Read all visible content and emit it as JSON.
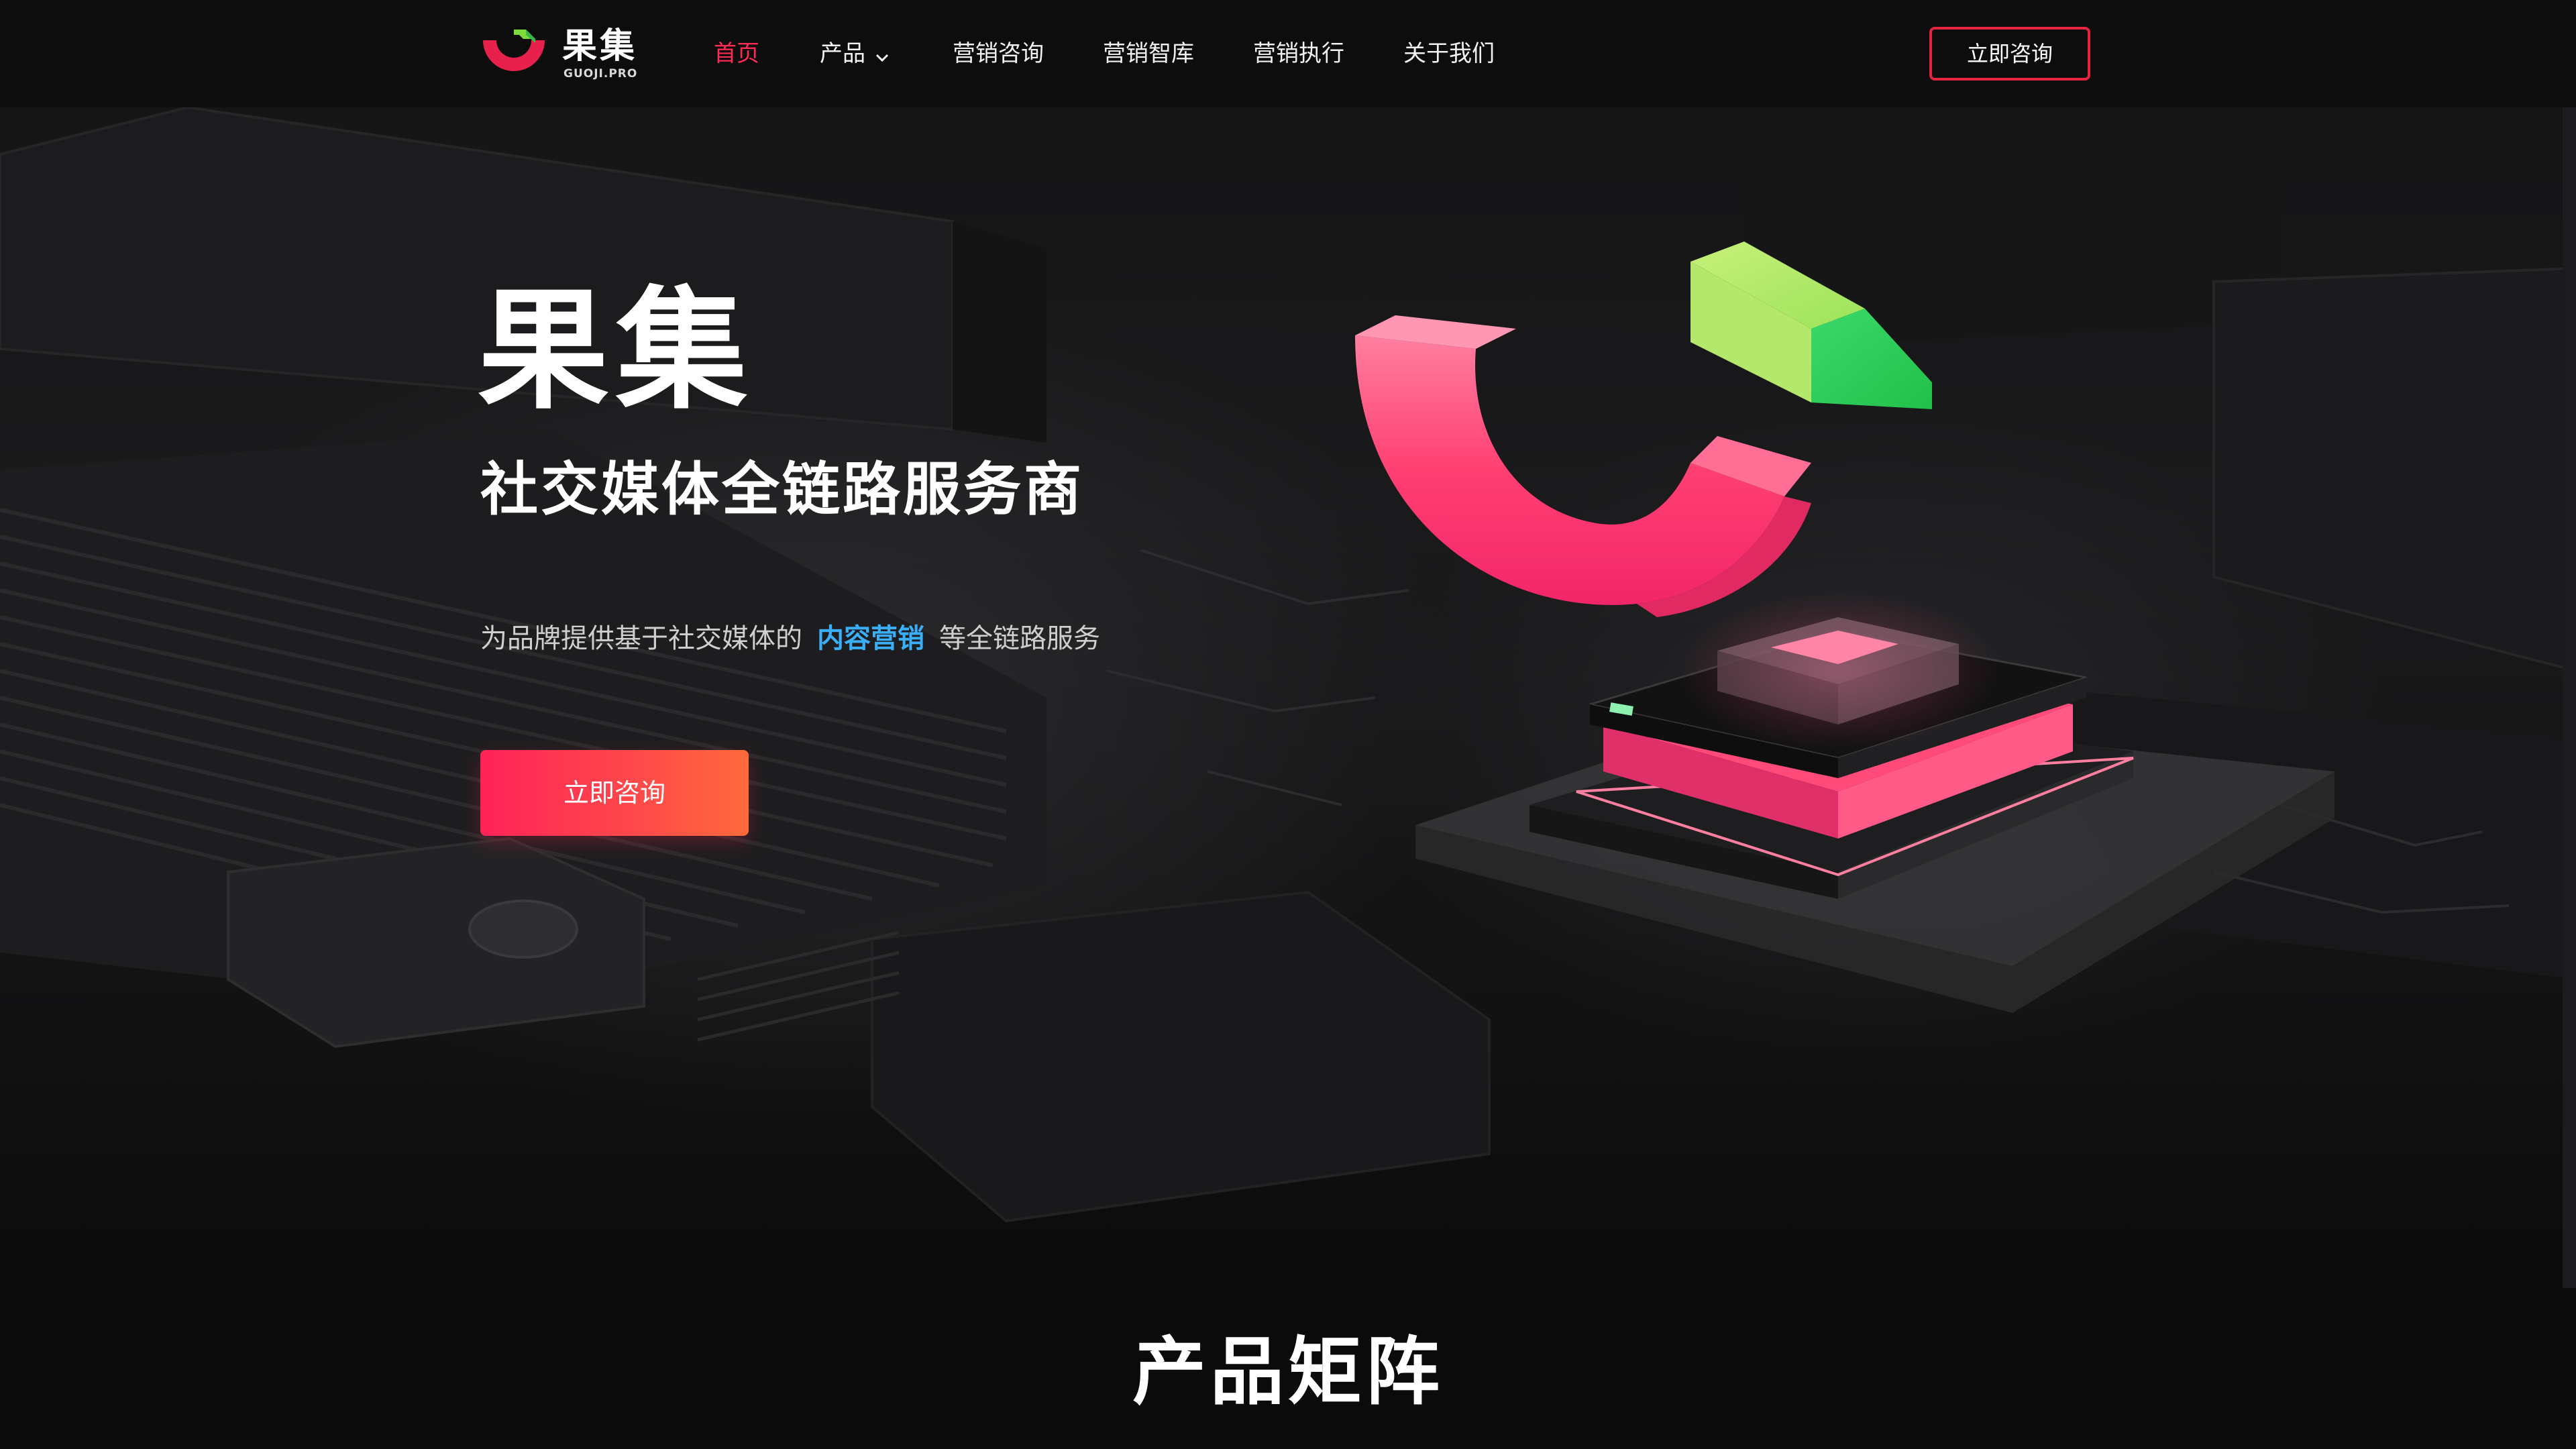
{
  "brand": {
    "name_cn": "果集",
    "name_en": "GUOJI.PRO",
    "colors": {
      "primary": "#ff2c55",
      "accent_green": "#7ddc3a",
      "highlight_blue": "#3aaef6",
      "background": "#0b0b0c"
    }
  },
  "nav": {
    "items": [
      {
        "label": "首页",
        "active": true
      },
      {
        "label": "产品",
        "has_dropdown": true,
        "icon": "chevron-down-icon"
      },
      {
        "label": "营销咨询"
      },
      {
        "label": "营销智库"
      },
      {
        "label": "营销执行"
      },
      {
        "label": "关于我们"
      }
    ],
    "cta_label": "立即咨询"
  },
  "hero": {
    "title": "果集",
    "subtitle": "社交媒体全链路服务商",
    "desc_before": "为品牌提供基于社交媒体的",
    "desc_highlight": "内容营销",
    "desc_after": "等全链路服务",
    "cta_label": "立即咨询",
    "illustration": "3d-logo-on-chip"
  },
  "products": {
    "section_title": "产品矩阵"
  }
}
